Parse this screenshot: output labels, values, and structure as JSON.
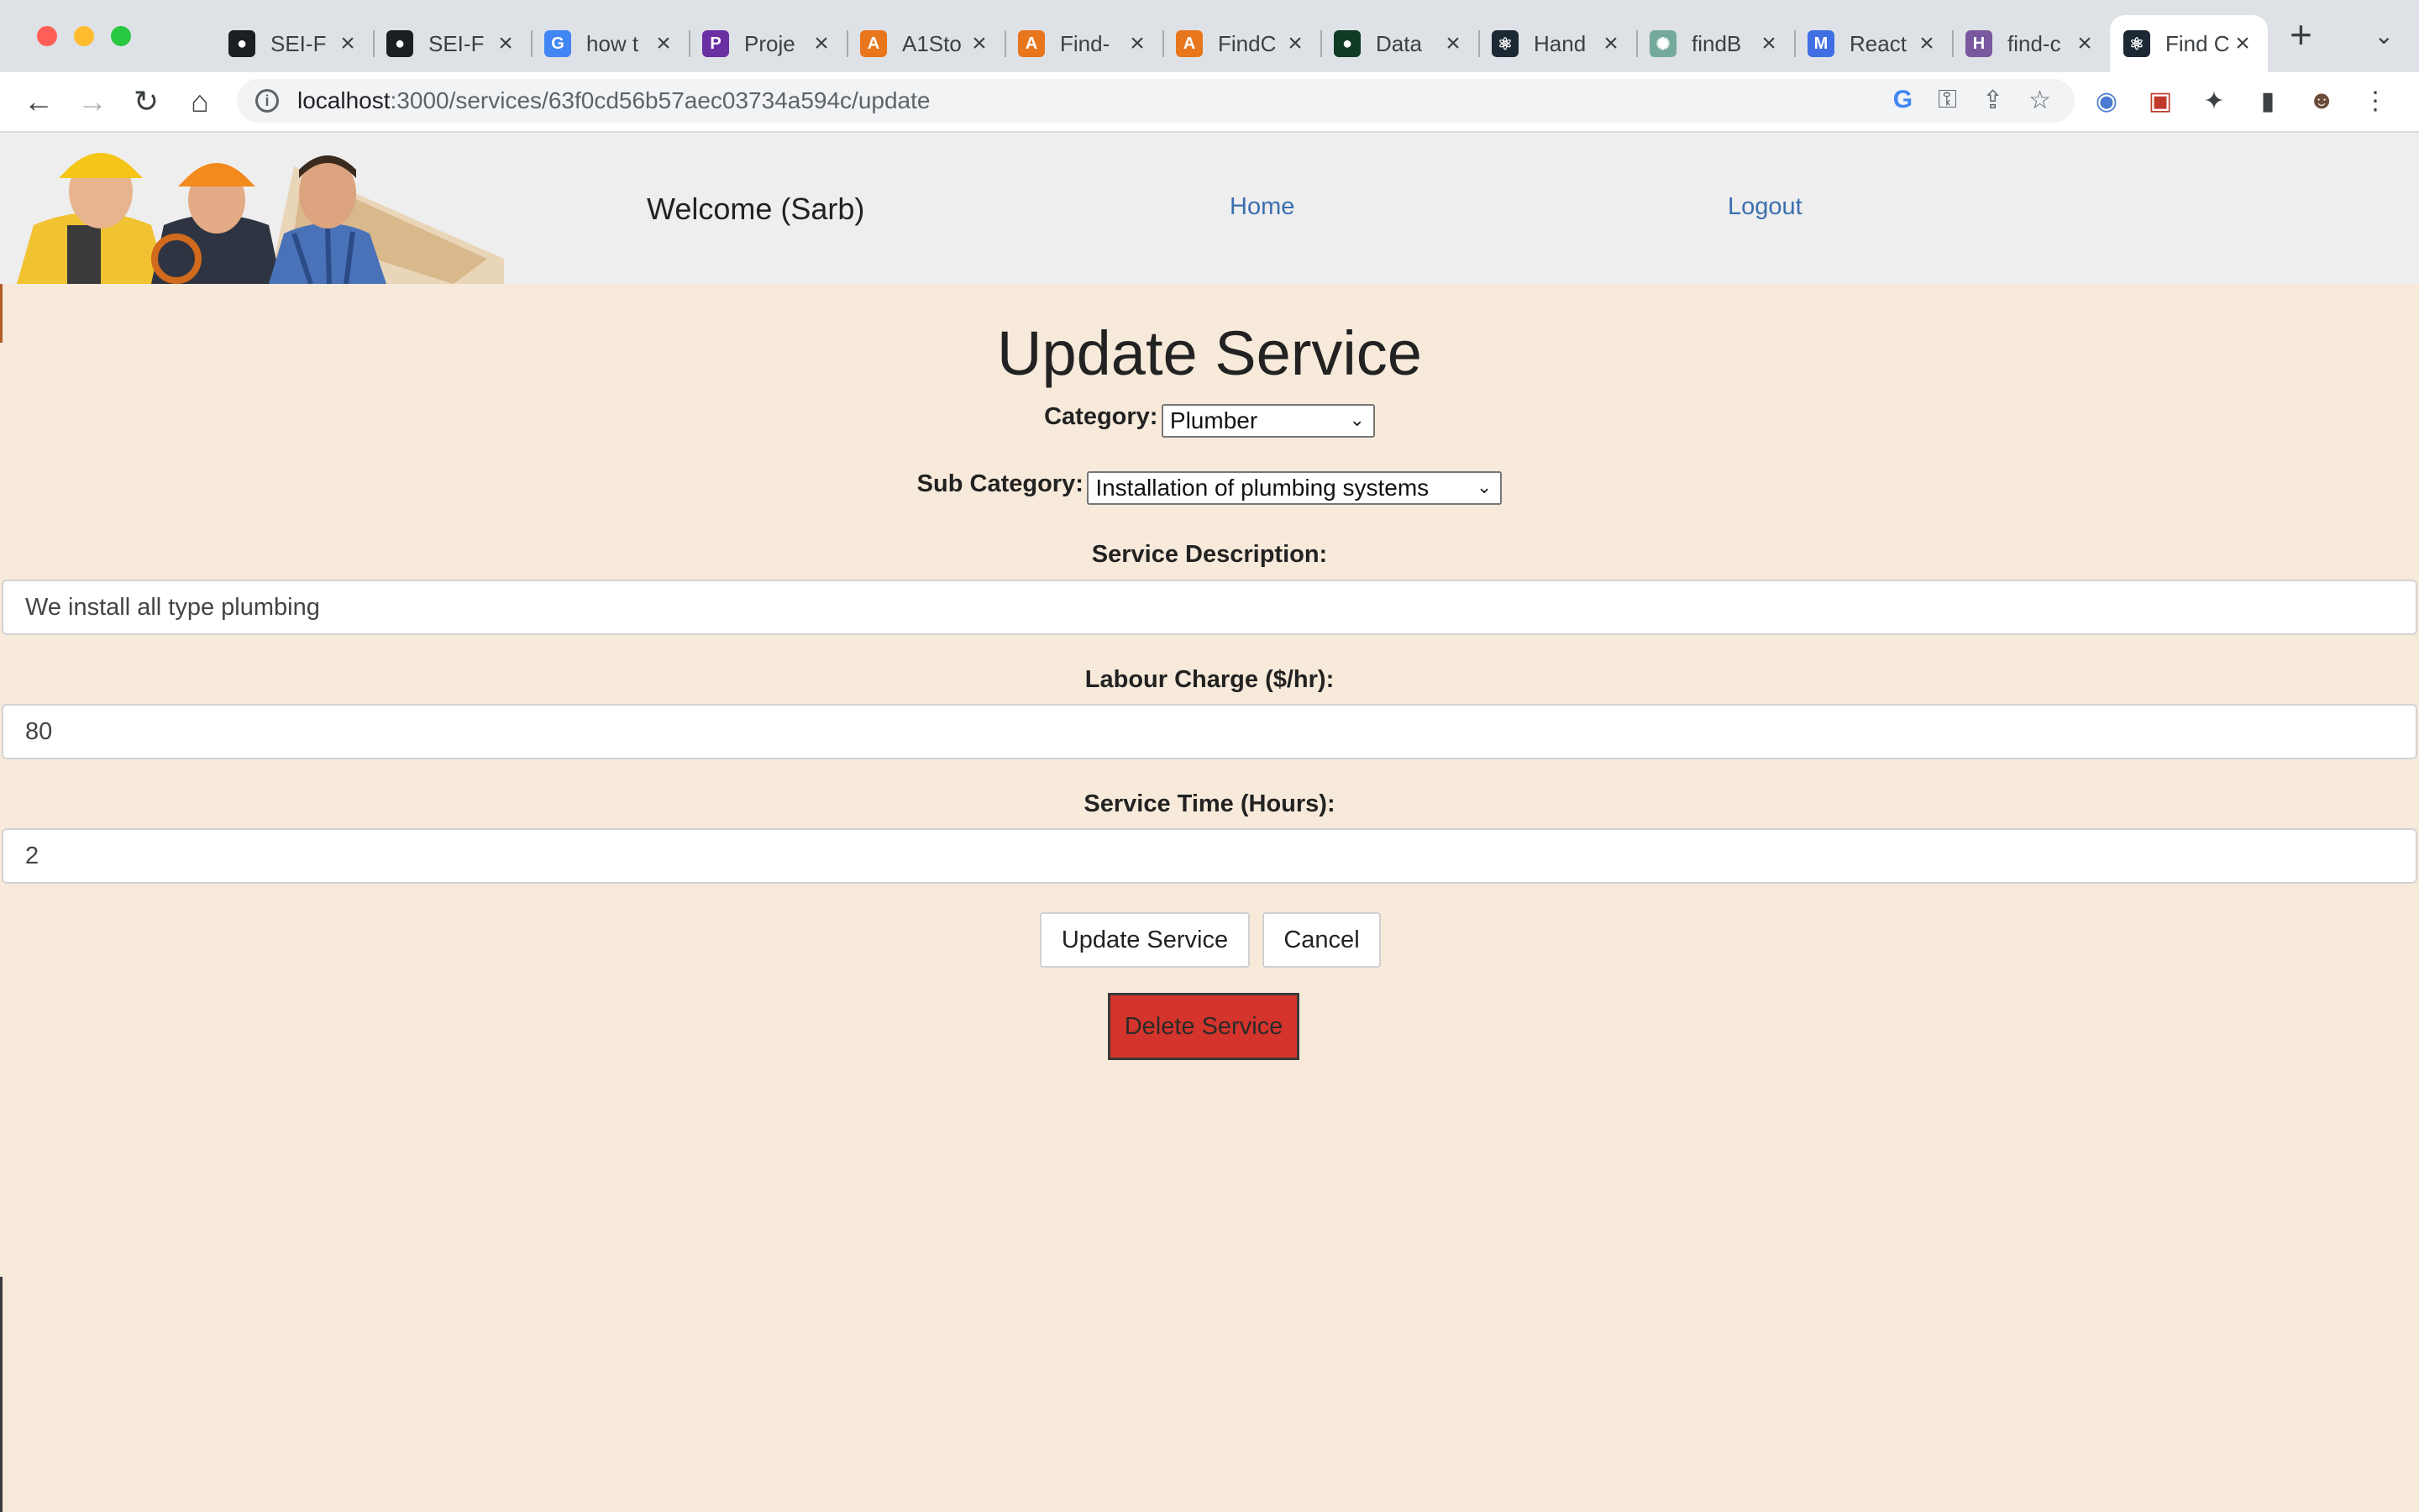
{
  "browser": {
    "tabs": [
      {
        "title": "SEI-F",
        "icon": "github-icon",
        "color": "#1b1f23",
        "glyph": "●"
      },
      {
        "title": "SEI-F",
        "icon": "github-icon",
        "color": "#1b1f23",
        "glyph": "●"
      },
      {
        "title": "how t",
        "icon": "google-icon",
        "color": "#4285f4",
        "glyph": "G"
      },
      {
        "title": "Proje",
        "icon": "project-icon",
        "color": "#6b2fa3",
        "glyph": "P"
      },
      {
        "title": "A1Sto",
        "icon": "aws-amplify-icon",
        "color": "#e8761c",
        "glyph": "A"
      },
      {
        "title": "Find-",
        "icon": "aws-amplify-icon",
        "color": "#e8761c",
        "glyph": "A"
      },
      {
        "title": "FindC",
        "icon": "aws-amplify-icon",
        "color": "#e8761c",
        "glyph": "A"
      },
      {
        "title": "Data",
        "icon": "mongodb-icon",
        "color": "#0f3b24",
        "glyph": "●"
      },
      {
        "title": "Hand",
        "icon": "react-icon",
        "color": "#1d2835",
        "glyph": "⚛"
      },
      {
        "title": "findB",
        "icon": "chatgpt-icon",
        "color": "#74aa9c",
        "glyph": "✺"
      },
      {
        "title": "React",
        "icon": "mui-icon",
        "color": "#3f6fe3",
        "glyph": "M"
      },
      {
        "title": "find-c",
        "icon": "heroku-icon",
        "color": "#79589f",
        "glyph": "H"
      },
      {
        "title": "Find C",
        "icon": "react-icon",
        "color": "#1d2835",
        "glyph": "⚛",
        "active": true
      }
    ],
    "url_host": "localhost",
    "url_path": ":3000/services/63f0cd56b57aec03734a594c/update"
  },
  "header": {
    "welcome": "Welcome (Sarb)",
    "nav": {
      "home": "Home",
      "logout": "Logout"
    }
  },
  "form": {
    "title": "Update Service",
    "category_label": "Category:",
    "category_value": "Plumber",
    "subcategory_label": "Sub Category:",
    "subcategory_value": "Installation of plumbing systems",
    "description_label": "Service Description:",
    "description_value": "We install all type plumbing",
    "labour_label": "Labour Charge ($/hr):",
    "labour_value": "80",
    "time_label": "Service Time (Hours):",
    "time_value": "2",
    "update_button": "Update Service",
    "cancel_button": "Cancel",
    "delete_button": "Delete Service"
  },
  "colors": {
    "page_bg": "#f7eadb",
    "header_bg": "#eeeeee",
    "link": "#3b6fb0",
    "danger": "#d4342b"
  }
}
